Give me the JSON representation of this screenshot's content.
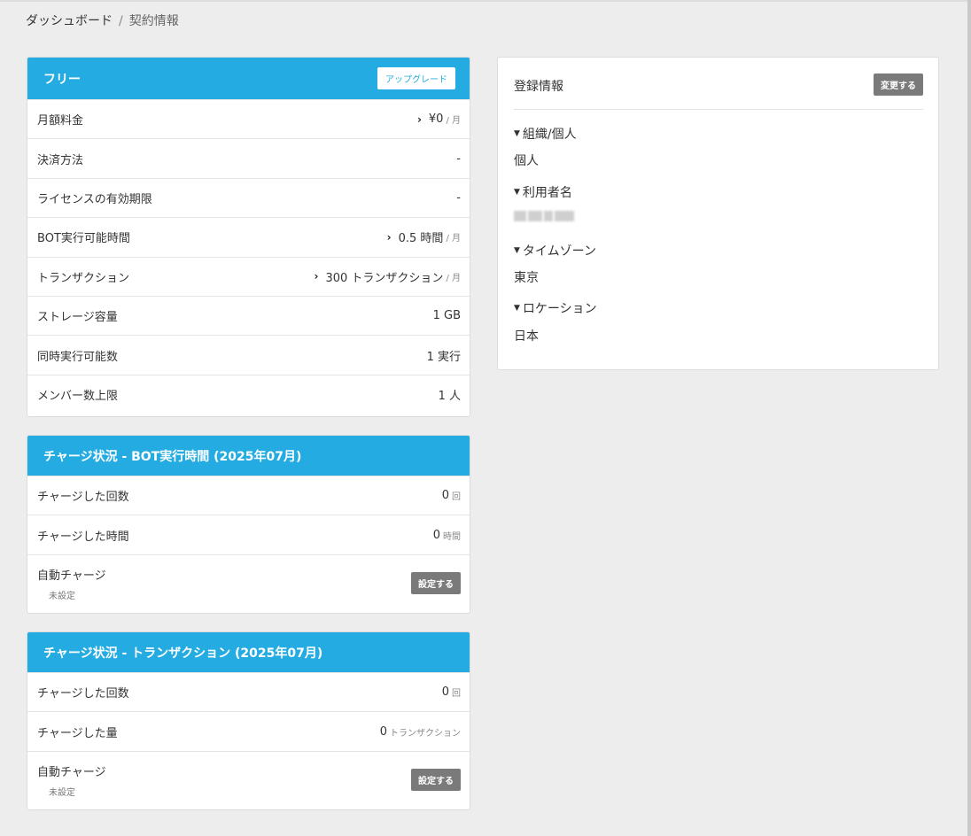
{
  "breadcrumb": {
    "home": "ダッシュボード",
    "separator": "/",
    "current": "契約情報"
  },
  "plan_card": {
    "title": "フリー",
    "upgrade_label": "アップグレード",
    "rows": [
      {
        "label": "月額料金",
        "value": "¥0",
        "unit": "/ 月",
        "chevron": true
      },
      {
        "label": "決済方法",
        "value": "-",
        "unit": "",
        "chevron": false
      },
      {
        "label": "ライセンスの有効期限",
        "value": "-",
        "unit": "",
        "chevron": false
      },
      {
        "label": "BOT実行可能時間",
        "value": "0.5 時間",
        "unit": "/ 月",
        "chevron": true
      },
      {
        "label": "トランザクション",
        "value": "300 トランザクション",
        "unit": "/ 月",
        "chevron": true
      },
      {
        "label": "ストレージ容量",
        "value": "1 GB",
        "unit": "",
        "chevron": false
      },
      {
        "label": "同時実行可能数",
        "value": "1 実行",
        "unit": "",
        "chevron": false
      },
      {
        "label": "メンバー数上限",
        "value": "1 人",
        "unit": "",
        "chevron": false
      }
    ]
  },
  "charge_bot": {
    "title": "チャージ状況 - BOT実行時間 (2025年07月)",
    "rows": [
      {
        "label": "チャージした回数",
        "value": "0",
        "unit": "回"
      },
      {
        "label": "チャージした時間",
        "value": "0",
        "unit": "時間"
      }
    ],
    "auto_label": "自動チャージ",
    "auto_status": "未設定",
    "set_label": "設定する"
  },
  "charge_tx": {
    "title": "チャージ状況 - トランザクション (2025年07月)",
    "rows": [
      {
        "label": "チャージした回数",
        "value": "0",
        "unit": "回"
      },
      {
        "label": "チャージした量",
        "value": "0",
        "unit": "トランザクション"
      }
    ],
    "auto_label": "自動チャージ",
    "auto_status": "未設定",
    "set_label": "設定する"
  },
  "registration": {
    "title": "登録情報",
    "change_label": "変更する",
    "fields": [
      {
        "label": "組織/個人",
        "value": "個人"
      },
      {
        "label": "利用者名",
        "value": ""
      },
      {
        "label": "タイムゾーン",
        "value": "東京"
      },
      {
        "label": "ロケーション",
        "value": "日本"
      }
    ]
  },
  "colors": {
    "header_blue": "#24ace2",
    "button_gray": "#7a7a7a",
    "page_bg": "#ededed"
  }
}
